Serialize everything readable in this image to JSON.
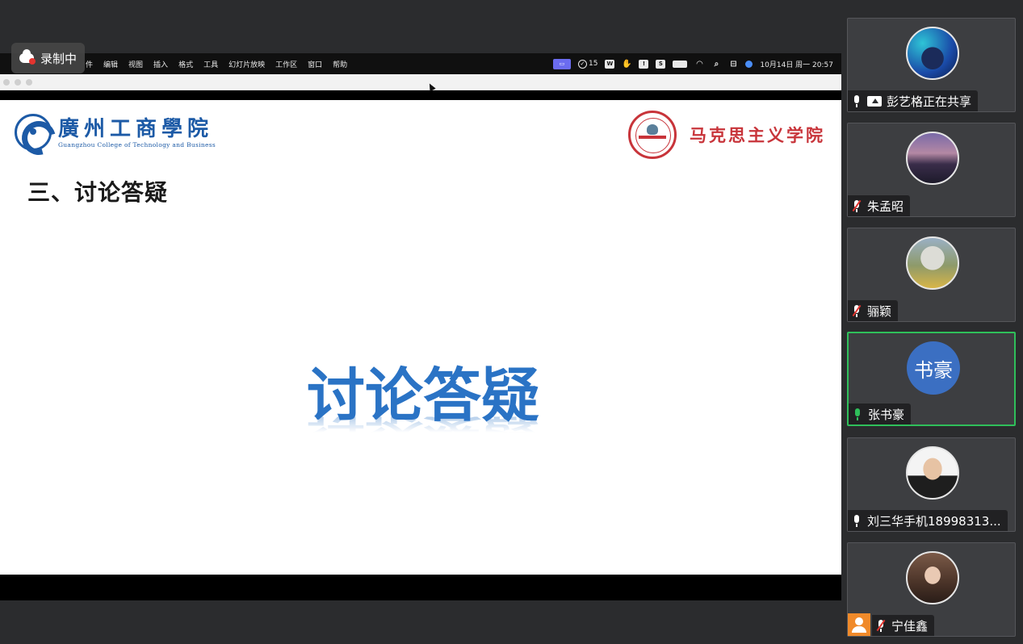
{
  "screen": {
    "menubar": {
      "items": [
        "件",
        "编辑",
        "视图",
        "插入",
        "格式",
        "工具",
        "幻灯片放映",
        "工作区",
        "窗口",
        "帮助"
      ],
      "status": {
        "count_badge": "15",
        "datetime": "10月14日 周一  20:57"
      }
    }
  },
  "recording": {
    "label": "录制中"
  },
  "slide": {
    "school_name": "廣州工商學院",
    "school_name_en": "Guangzhou College of Technology and Business",
    "department": "马克思主义学院",
    "section_title": "三、讨论答疑",
    "big_title": "讨论答疑"
  },
  "participants": [
    {
      "name": "彭艺格正在共享",
      "mic": "on",
      "sharing": true,
      "avatar": "photo"
    },
    {
      "name": "朱孟昭",
      "mic": "muted",
      "avatar": "photo"
    },
    {
      "name": "骊颖",
      "mic": "muted",
      "avatar": "photo"
    },
    {
      "name": "张书豪",
      "mic": "active",
      "avatar_text": "书豪",
      "speaking": true
    },
    {
      "name": "刘三华手机18998313...",
      "mic": "on",
      "avatar": "photo"
    },
    {
      "name": "宁佳鑫",
      "mic": "muted",
      "avatar": "photo",
      "host": true
    }
  ],
  "colors": {
    "speaking_border": "#2fbf5a",
    "title_blue": "#2a73c5",
    "school_blue": "#1c5aa6",
    "dept_red": "#c8343a",
    "avatar_blue": "#3b6fc2"
  }
}
